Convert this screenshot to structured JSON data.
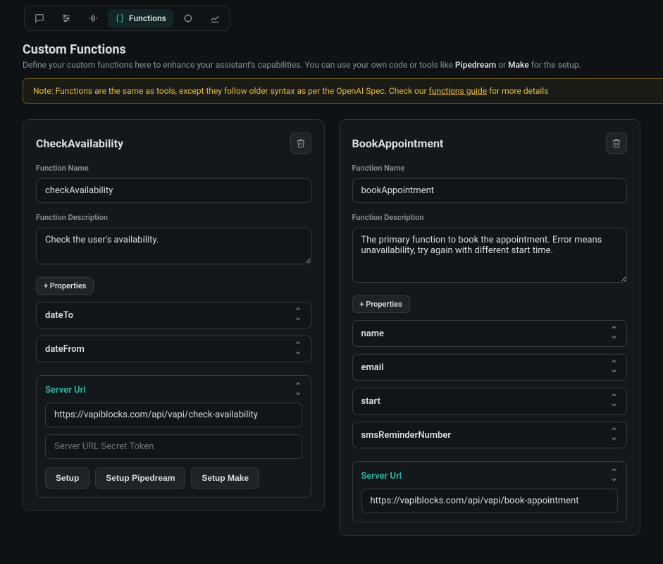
{
  "tabs": {
    "active_label": "Functions"
  },
  "header": {
    "title": "Custom Functions",
    "desc_pre": "Define your custom functions here to enhance your assistant's capabilities. You can use your own code or tools like ",
    "desc_b1": "Pipedream",
    "desc_mid": " or ",
    "desc_b2": "Make",
    "desc_post": " for the setup."
  },
  "note": {
    "pre": "Note: Functions are the same as tools, except they follow older syntax as per the OpenAI Spec. Check our ",
    "link": "functions guide",
    "post": " for more details"
  },
  "labels": {
    "fn_name": "Function Name",
    "fn_desc": "Function Description",
    "props": "+ Properties",
    "server_url": "Server Url",
    "secret_placeholder": "Server URL Secret Token",
    "btn_setup": "Setup",
    "btn_pipedream": "Setup Pipedream",
    "btn_make": "Setup Make"
  },
  "fns": [
    {
      "title": "CheckAvailability",
      "name": "checkAvailability",
      "desc": "Check the user's availability.",
      "props": [
        "dateTo",
        "dateFrom"
      ],
      "server_url": "https://vapiblocks.com/api/vapi/check-availability",
      "secret": ""
    },
    {
      "title": "BookAppointment",
      "name": "bookAppointment",
      "desc": "The primary function to book the appointment. Error means unavailability, try again with different start time.",
      "props": [
        "name",
        "email",
        "start",
        "smsReminderNumber"
      ],
      "server_url": "https://vapiblocks.com/api/vapi/book-appointment",
      "secret": ""
    }
  ]
}
